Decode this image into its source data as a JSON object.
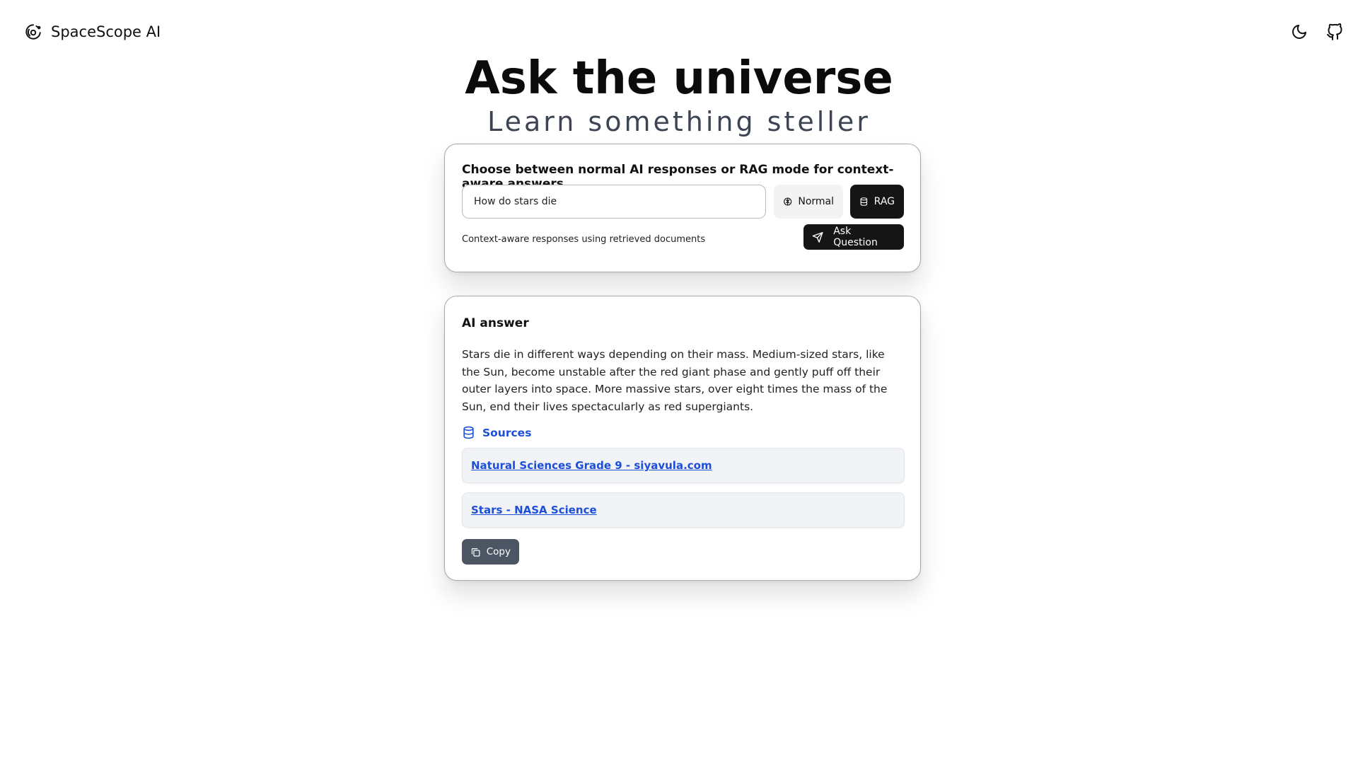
{
  "nav": {
    "brand_name": "SpaceScope AI",
    "icons": [
      "planet-logo-icon",
      "moon-icon",
      "github-icon"
    ]
  },
  "hero": {
    "title": "Ask the universe",
    "subtitle": "Learn something steller"
  },
  "query": {
    "heading": "Choose between normal AI responses or RAG mode for context-aware answers.",
    "input_value": "How do stars die",
    "modes": [
      {
        "label": "Normal",
        "icon": "brain-icon",
        "selected": false
      },
      {
        "label": "RAG",
        "icon": "database-icon",
        "selected": true
      }
    ],
    "mode_hint": "Context-aware responses using retrieved documents",
    "ask_label": "Ask Question"
  },
  "answer": {
    "title": "AI answer",
    "text": "Stars die in different ways depending on their mass. Medium-sized stars, like the Sun, become unstable after the red giant phase and gently puff off their outer layers into space. More massive stars, over eight times the mass of the Sun, end their lives spectacularly as red supergiants.",
    "sources_label": "Sources",
    "sources": [
      {
        "title": "Natural Sciences Grade 9 - siyavula.com"
      },
      {
        "title": "Stars - NASA Science"
      }
    ],
    "copy_label": "Copy"
  },
  "colors": {
    "link": "#1d4ed8",
    "dark_button": "#151515",
    "copy_button": "#4b5563",
    "source_bg": "#f1f3f7"
  }
}
